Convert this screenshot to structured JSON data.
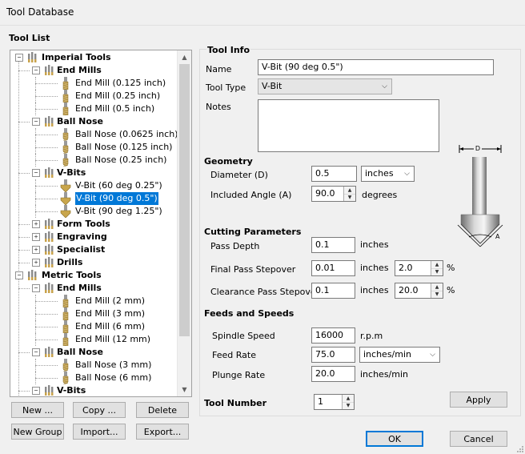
{
  "window": {
    "title": "Tool Database"
  },
  "tool_list": {
    "heading": "Tool List",
    "tree": [
      {
        "label": "Imperial Tools",
        "kind": "group",
        "level": 0,
        "expander": "−"
      },
      {
        "label": "End Mills",
        "kind": "folder",
        "level": 1,
        "expander": "−"
      },
      {
        "label": "End Mill (0.125 inch)",
        "kind": "tool",
        "level": 2,
        "icon": "end-mill"
      },
      {
        "label": "End Mill (0.25 inch)",
        "kind": "tool",
        "level": 2,
        "icon": "end-mill"
      },
      {
        "label": "End Mill (0.5 inch)",
        "kind": "tool",
        "level": 2,
        "icon": "end-mill"
      },
      {
        "label": "Ball Nose",
        "kind": "folder",
        "level": 1,
        "expander": "−"
      },
      {
        "label": "Ball Nose (0.0625 inch)",
        "kind": "tool",
        "level": 2,
        "icon": "ball-nose"
      },
      {
        "label": "Ball Nose (0.125 inch)",
        "kind": "tool",
        "level": 2,
        "icon": "ball-nose"
      },
      {
        "label": "Ball Nose (0.25 inch)",
        "kind": "tool",
        "level": 2,
        "icon": "ball-nose"
      },
      {
        "label": "V-Bits",
        "kind": "folder",
        "level": 1,
        "expander": "−"
      },
      {
        "label": "V-Bit (60 deg 0.25\")",
        "kind": "tool",
        "level": 2,
        "icon": "v-bit"
      },
      {
        "label": "V-Bit (90 deg 0.5\")",
        "kind": "tool",
        "level": 2,
        "icon": "v-bit",
        "selected": true
      },
      {
        "label": "V-Bit (90 deg 1.25\")",
        "kind": "tool",
        "level": 2,
        "icon": "v-bit"
      },
      {
        "label": "Form Tools",
        "kind": "folder",
        "level": 1,
        "expander": "+"
      },
      {
        "label": "Engraving",
        "kind": "folder",
        "level": 1,
        "expander": "+"
      },
      {
        "label": "Specialist",
        "kind": "folder",
        "level": 1,
        "expander": "+"
      },
      {
        "label": "Drills",
        "kind": "folder",
        "level": 1,
        "expander": "+"
      },
      {
        "label": "Metric Tools",
        "kind": "group",
        "level": 0,
        "expander": "−"
      },
      {
        "label": "End Mills",
        "kind": "folder",
        "level": 1,
        "expander": "−"
      },
      {
        "label": "End Mill (2 mm)",
        "kind": "tool",
        "level": 2,
        "icon": "end-mill"
      },
      {
        "label": "End Mill (3 mm)",
        "kind": "tool",
        "level": 2,
        "icon": "end-mill"
      },
      {
        "label": "End Mill (6 mm)",
        "kind": "tool",
        "level": 2,
        "icon": "end-mill"
      },
      {
        "label": "End Mill (12 mm)",
        "kind": "tool",
        "level": 2,
        "icon": "end-mill"
      },
      {
        "label": "Ball Nose",
        "kind": "folder",
        "level": 1,
        "expander": "−"
      },
      {
        "label": "Ball Nose (3 mm)",
        "kind": "tool",
        "level": 2,
        "icon": "ball-nose"
      },
      {
        "label": "Ball Nose (6 mm)",
        "kind": "tool",
        "level": 2,
        "icon": "ball-nose"
      },
      {
        "label": "V-Bits",
        "kind": "folder",
        "level": 1,
        "expander": "−"
      }
    ],
    "buttons": {
      "new": "New ...",
      "copy": "Copy ...",
      "delete": "Delete",
      "new_group": "New Group",
      "import": "Import...",
      "export": "Export..."
    }
  },
  "tool_info": {
    "heading": "Tool Info",
    "name_label": "Name",
    "name_value": "V-Bit (90 deg 0.5\")",
    "type_label": "Tool Type",
    "type_value": "V-Bit",
    "notes_label": "Notes",
    "notes_value": ""
  },
  "geometry": {
    "heading": "Geometry",
    "diameter_label": "Diameter (D)",
    "diameter_value": "0.5",
    "diameter_units": "inches",
    "angle_label": "Included Angle (A)",
    "angle_value": "90.0",
    "angle_units": "degrees",
    "diagram_labels": {
      "d": "D",
      "a": "A"
    }
  },
  "cutting": {
    "heading": "Cutting Parameters",
    "pass_depth_label": "Pass Depth",
    "pass_depth_value": "0.1",
    "pass_depth_units": "inches",
    "final_label": "Final Pass Stepover",
    "final_value": "0.01",
    "final_units": "inches",
    "final_pct": "2.0",
    "clearance_label": "Clearance Pass Stepover",
    "clearance_value": "0.1",
    "clearance_units": "inches",
    "clearance_pct": "20.0",
    "pct_symbol": "%"
  },
  "feeds": {
    "heading": "Feeds and Speeds",
    "spindle_label": "Spindle Speed",
    "spindle_value": "16000",
    "spindle_units": "r.p.m",
    "feed_label": "Feed Rate",
    "feed_value": "75.0",
    "feed_units": "inches/min",
    "plunge_label": "Plunge Rate",
    "plunge_value": "20.0",
    "plunge_units": "inches/min"
  },
  "tool_number": {
    "label": "Tool Number",
    "value": "1"
  },
  "dialog_buttons": {
    "apply": "Apply",
    "ok": "OK",
    "cancel": "Cancel"
  }
}
